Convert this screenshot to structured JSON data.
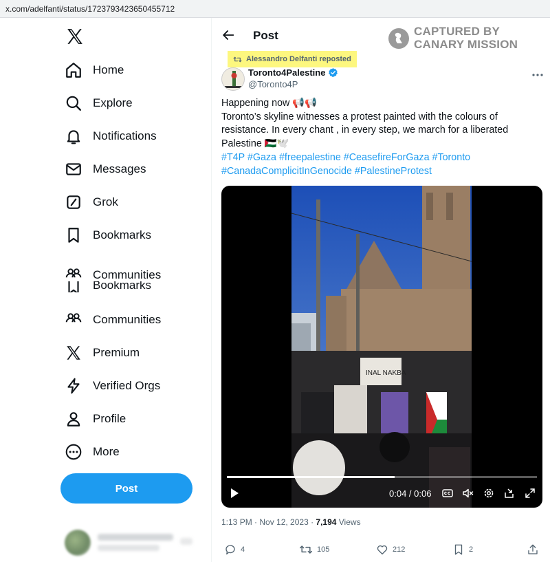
{
  "browser": {
    "url": "x.com/adelfanti/status/1723793423650455712"
  },
  "sidebar": {
    "items": [
      {
        "label": "Home",
        "icon": "home-icon"
      },
      {
        "label": "Explore",
        "icon": "search-icon"
      },
      {
        "label": "Notifications",
        "icon": "bell-icon"
      },
      {
        "label": "Messages",
        "icon": "envelope-icon"
      },
      {
        "label": "Grok",
        "icon": "grok-icon"
      },
      {
        "label": "Bookmarks",
        "icon": "bookmark-icon"
      },
      {
        "label": "Communities",
        "icon": "communities-icon"
      },
      {
        "label": "Communities",
        "icon": "communities-icon"
      },
      {
        "label": "Premium",
        "icon": "x-logo-icon"
      },
      {
        "label": "Verified Orgs",
        "icon": "lightning-icon"
      },
      {
        "label": "Profile",
        "icon": "person-icon"
      },
      {
        "label": "More",
        "icon": "more-circle-icon"
      }
    ],
    "ghost_label": "Bookmarks",
    "post_button": "Post"
  },
  "header": {
    "title": "Post",
    "watermark_line1": "CAPTURED BY",
    "watermark_line2": "CANARY MISSION"
  },
  "tweet": {
    "repost_label": "Alessandro Delfanti reposted",
    "display_name": "Toronto4Palestine",
    "handle": "@Toronto4P",
    "text_line1": "Happening now 📢📢",
    "text_line2": "Toronto’s skyline witnesses a protest painted with the colours of resistance. In every chant , in every step, we march for a liberated Palestine 🇵🇸🕊️",
    "hashtags_line1": "#T4P #Gaza #freepalestine #CeasefireForGaza #Toronto",
    "hashtags_line2": "#CanadaComplicitInGenocide #PalestineProtest",
    "time": "1:13 PM · Nov 12, 2023 · ",
    "views_count": "7,194",
    "views_label": " Views"
  },
  "video": {
    "time_display": "0:04 / 0:06",
    "progress": 0.54,
    "sign_text": "INAL NAKBA"
  },
  "actions": {
    "replies": "4",
    "reposts": "105",
    "likes": "212",
    "bookmarks": "2"
  },
  "colors": {
    "accent": "#1d9bf0",
    "highlight": "#fdf77f",
    "text": "#0f1419",
    "muted": "#536471"
  }
}
